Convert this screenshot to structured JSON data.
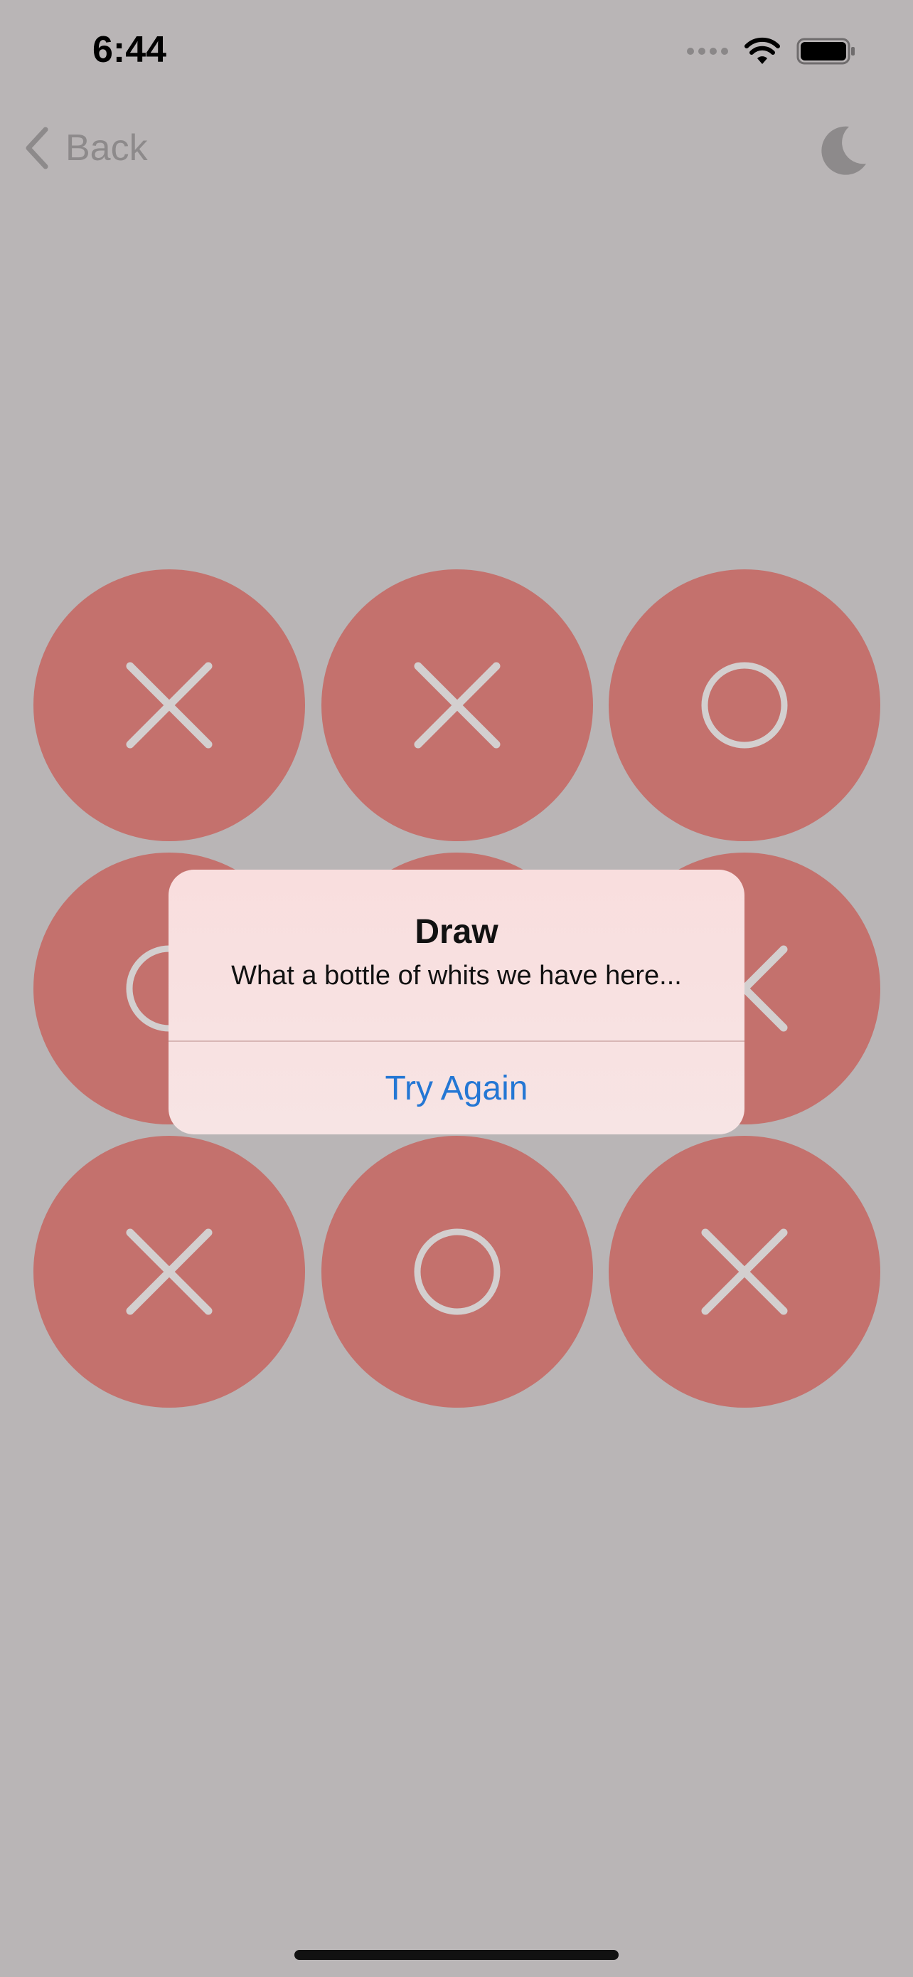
{
  "status_bar": {
    "time": "6:44"
  },
  "nav": {
    "back_label": "Back",
    "back_icon": "chevron-left-icon",
    "theme_icon": "moon-icon"
  },
  "board": {
    "cells": [
      "X",
      "X",
      "O",
      "O",
      "",
      "X",
      "X",
      "O",
      "X"
    ]
  },
  "alert": {
    "title": "Draw",
    "message": "What a bottle of whits we have here...",
    "button_label": "Try Again"
  },
  "colors": {
    "background": "#b9b5b6",
    "cell": "#c4716d",
    "mark": "#d3cfcf",
    "alert_button": "#2477d4"
  }
}
